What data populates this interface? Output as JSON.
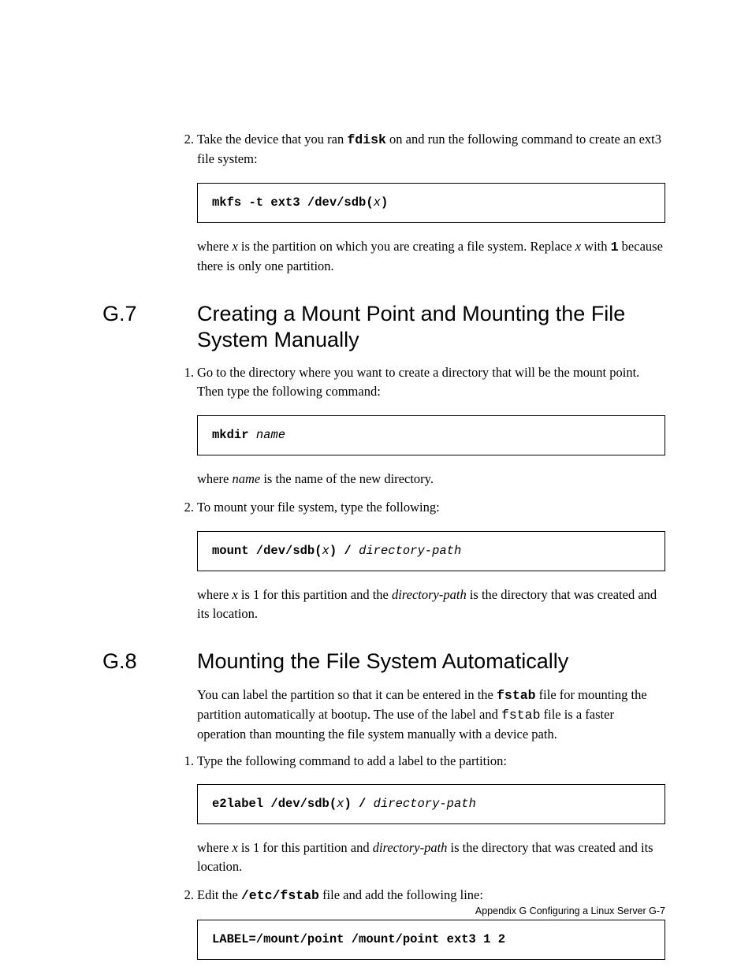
{
  "step2": {
    "num": "2.",
    "text_parts": [
      "Take the device that you ran ",
      "fdisk",
      " on and run the following command to create an ext3 file system:"
    ],
    "code_parts": [
      "mkfs -t ext3 /dev/sdb(",
      "x",
      ")"
    ],
    "after_parts": [
      "where ",
      "x",
      " is the partition on which you are creating a file system. Replace ",
      "x",
      " with ",
      "1",
      " because there is only one partition."
    ]
  },
  "g7": {
    "num": "G.7",
    "title": "Creating a Mount Point and Mounting the File System Manually",
    "step1": {
      "num": "1.",
      "text": "Go to the directory where you want to create a directory that will be the mount point. Then type the following command:",
      "code_parts": [
        "mkdir ",
        "name"
      ],
      "after_parts": [
        "where ",
        "name",
        " is the name of the new directory."
      ]
    },
    "step2": {
      "num": "2.",
      "text": "To mount your file system, type the following:",
      "code_parts": [
        "mount /dev/sdb(",
        "x",
        ") / ",
        "directory-path"
      ],
      "after_parts": [
        "where ",
        "x",
        " is 1 for this partition and the ",
        "directory-path",
        " is the directory that was created and its location."
      ]
    }
  },
  "g8": {
    "num": "G.8",
    "title": "Mounting the File System Automatically",
    "intro_parts": [
      "You can label the partition so that it can be entered in the ",
      "fstab",
      " file for mounting the partition automatically at bootup. The use of the label and ",
      "fstab",
      " file is a faster operation than mounting the file system manually with a device path."
    ],
    "step1": {
      "num": "1.",
      "text": "Type the following command to add a label to the partition:",
      "code_parts": [
        "e2label /dev/sdb(",
        "x",
        ") / ",
        "directory-path"
      ],
      "after_parts": [
        "where ",
        "x",
        " is 1 for this partition and ",
        "directory-path",
        " is the directory that was created and its location."
      ]
    },
    "step2": {
      "num": "2.",
      "text_parts": [
        "Edit the ",
        "/etc/fstab",
        " file and add the following line:"
      ],
      "code": "LABEL=/mount/point /mount/point ext3  1 2"
    }
  },
  "footer": "Appendix G   Configuring a Linux Server G-7"
}
